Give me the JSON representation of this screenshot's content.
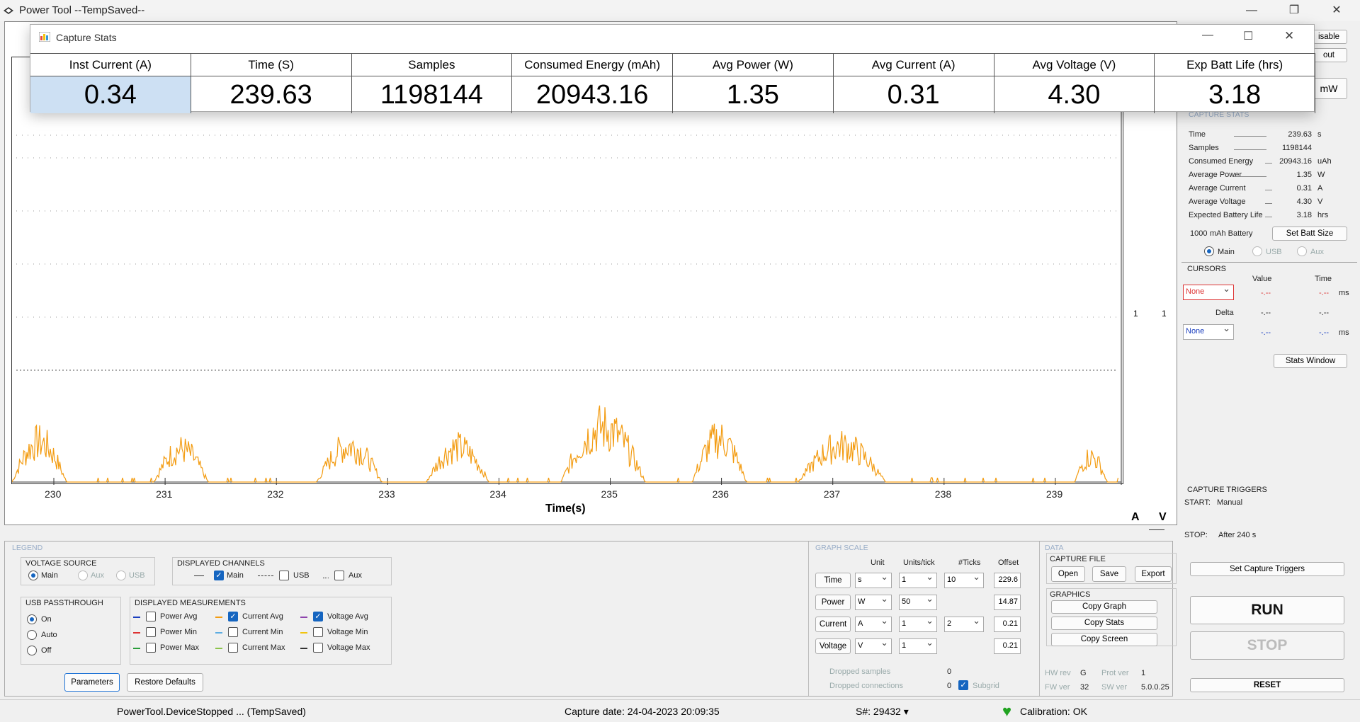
{
  "app": {
    "title": "Power Tool --TempSaved--"
  },
  "popup": {
    "title": "Capture Stats",
    "columns": [
      {
        "header": "Inst Current (A)",
        "value": "0.34"
      },
      {
        "header": "Time (S)",
        "value": "239.63"
      },
      {
        "header": "Samples",
        "value": "1198144"
      },
      {
        "header": "Consumed Energy (mAh)",
        "value": "20943.16"
      },
      {
        "header": "Avg Power (W)",
        "value": "1.35"
      },
      {
        "header": "Avg Current (A)",
        "value": "0.31"
      },
      {
        "header": "Avg Voltage (V)",
        "value": "4.30"
      },
      {
        "header": "Exp Batt Life (hrs)",
        "value": "3.18"
      }
    ]
  },
  "toolbar": {
    "disable_label": "isable",
    "out_label": "out",
    "unit_label": "mW"
  },
  "graph": {
    "xtick_labels": [
      "230",
      "231",
      "232",
      "233",
      "234",
      "235",
      "236",
      "237",
      "238",
      "239"
    ],
    "xlabel": "Time(s)",
    "right_axis_labels": [
      "1",
      "1"
    ],
    "axis_letters": [
      "A",
      "V"
    ],
    "trace_color": "#f39c12"
  },
  "capture_stats": {
    "title": "CAPTURE STATS",
    "rows": [
      {
        "label": "Time",
        "value": "239.63",
        "unit": "s"
      },
      {
        "label": "Samples",
        "value": "1198144",
        "unit": ""
      },
      {
        "label": "Consumed Energy",
        "value": "20943.16",
        "unit": "uAh"
      },
      {
        "label": "Average Power",
        "value": "1.35",
        "unit": "W"
      },
      {
        "label": "Average Current",
        "value": "0.31",
        "unit": "A"
      },
      {
        "label": "Average Voltage",
        "value": "4.30",
        "unit": "V"
      },
      {
        "label": "Expected Battery Life",
        "value": "3.18",
        "unit": "hrs"
      }
    ],
    "battery_value": "1000",
    "battery_label": "mAh Battery",
    "set_batt_size": "Set Batt Size",
    "sources": [
      "Main",
      "USB",
      "Aux"
    ]
  },
  "cursors": {
    "title": "CURSORS",
    "value_header": "Value",
    "time_header": "Time",
    "cursor1": "None",
    "cursor2": "None",
    "dash": "-.--",
    "unit": "ms",
    "delta_label": "Delta",
    "stats_window": "Stats Window"
  },
  "triggers": {
    "title": "CAPTURE TRIGGERS",
    "start_label": "START:",
    "start_value": "Manual",
    "stop_label": "STOP:",
    "stop_value": "After 240 s",
    "set_button": "Set Capture Triggers"
  },
  "controls": {
    "run": "RUN",
    "stop": "STOP",
    "reset": "RESET"
  },
  "legend": {
    "title": "LEGEND",
    "voltage_source": {
      "title": "VOLTAGE SOURCE",
      "options": [
        "Main",
        "Aux",
        "USB"
      ]
    },
    "displayed_channels": {
      "title": "DISPLAYED CHANNELS",
      "main": "Main",
      "usb": "USB",
      "aux": "Aux"
    },
    "usb_passthrough": {
      "title": "USB PASSTHROUGH",
      "options": [
        "On",
        "Auto",
        "Off"
      ]
    },
    "displayed_measurements": {
      "title": "DISPLAYED MEASUREMENTS",
      "items": [
        "Power Avg",
        "Power Min",
        "Power Max",
        "Current Avg",
        "Current Min",
        "Current Max",
        "Voltage Avg",
        "Voltage Min",
        "Voltage Max"
      ]
    },
    "parameters": "Parameters",
    "restore_defaults": "Restore Defaults"
  },
  "graph_scale": {
    "title": "GRAPH SCALE",
    "headers": [
      "Unit",
      "Units/tick",
      "#Ticks",
      "Offset"
    ],
    "rows": [
      {
        "label": "Time",
        "unit": "s",
        "units_tick": "1",
        "ticks": "10",
        "offset": "229.6"
      },
      {
        "label": "Power",
        "unit": "W",
        "units_tick": "50",
        "ticks": "",
        "offset": "14.87"
      },
      {
        "label": "Current",
        "unit": "A",
        "units_tick": "1",
        "ticks": "2",
        "offset": "0.21"
      },
      {
        "label": "Voltage",
        "unit": "V",
        "units_tick": "1",
        "ticks": "",
        "offset": "0.21"
      }
    ],
    "dropped_samples_label": "Dropped samples",
    "dropped_samples_value": "0",
    "dropped_conn_label": "Dropped connections",
    "dropped_conn_value": "0",
    "subgrid": "Subgrid"
  },
  "data": {
    "title": "DATA",
    "capture_file": "CAPTURE FILE",
    "open": "Open",
    "save": "Save",
    "export": "Export",
    "graphics": "GRAPHICS",
    "copy_graph": "Copy Graph",
    "copy_stats": "Copy Stats",
    "copy_screen": "Copy Screen",
    "hw_rev_label": "HW rev",
    "hw_rev": "G",
    "prot_ver_label": "Prot ver",
    "prot_ver": "1",
    "fw_ver_label": "FW ver",
    "fw_ver": "32",
    "sw_ver_label": "SW ver",
    "sw_ver": "5.0.0.25"
  },
  "status": {
    "device": "PowerTool.DeviceStopped ... (TempSaved)",
    "capture_date": "Capture date: 24-04-2023 20:09:35",
    "serial": "S#: 29432",
    "calibration": "Calibration: OK"
  }
}
